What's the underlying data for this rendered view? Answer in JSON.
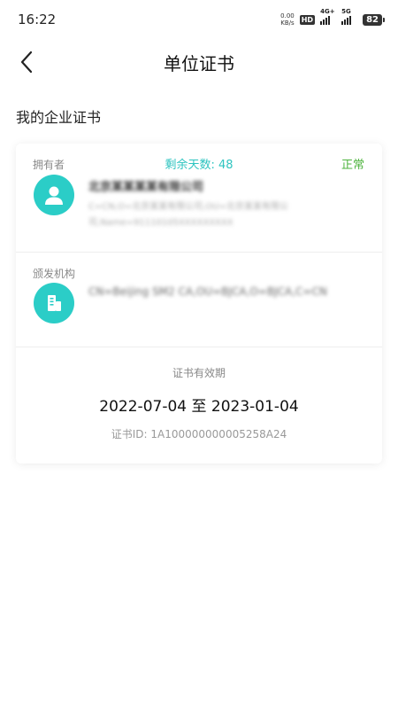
{
  "status_bar": {
    "time": "16:22",
    "net_speed_value": "0.00",
    "net_speed_unit": "KB/s",
    "hd": "HD",
    "sim1": "1",
    "sim2": "2",
    "net1": "4G+",
    "net2": "5G",
    "battery": "82"
  },
  "header": {
    "back_icon": "chevron-left-icon",
    "title": "单位证书"
  },
  "section_title": "我的企业证书",
  "card": {
    "owner_label": "拥有者",
    "remaining_label": "剩余天数: 48",
    "status": "正常",
    "status_color": "#4db33d",
    "accent_color": "#2bcdc7",
    "owner_name": "北京某某某某有限公司",
    "owner_detail": "C=CN,O=北京某某有限公司,OU=北京某某有限公司,Name=91110105XXXXXXXXX",
    "issuer_label": "颁发机构",
    "issuer_detail": "CN=Beijing SM2 CA,OU=BJCA,O=BJCA,C=CN",
    "validity_label": "证书有效期",
    "validity_range": "2022-07-04 至 2023-01-04",
    "cert_id": "证书ID: 1A100000000005258A24"
  }
}
